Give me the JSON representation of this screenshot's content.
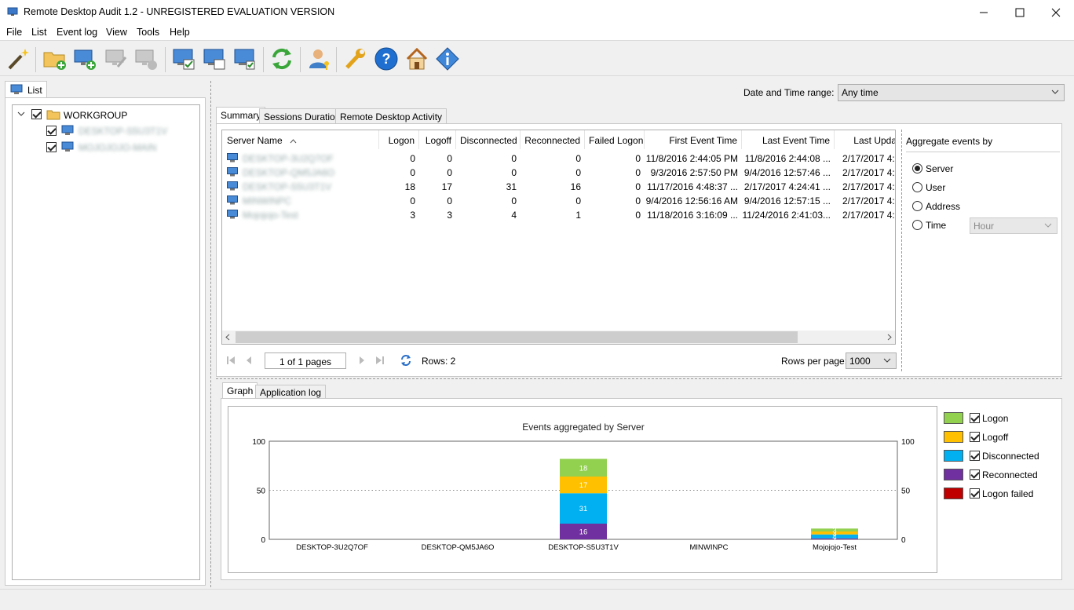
{
  "window": {
    "title": "Remote Desktop Audit 1.2 - UNREGISTERED EVALUATION VERSION"
  },
  "menu": [
    "File",
    "List",
    "Event log",
    "View",
    "Tools",
    "Help"
  ],
  "left": {
    "tab": "List",
    "tree": {
      "root": "WORKGROUP",
      "children": [
        "DESKTOP-S5U3T1V",
        "MOJOJOJO-MAIN"
      ]
    }
  },
  "range": {
    "label": "Date and Time range:",
    "value": "Any time"
  },
  "tabs": [
    "Summary",
    "Sessions Duration",
    "Remote Desktop Activity"
  ],
  "grid": {
    "headers": [
      "Server Name",
      "Logon",
      "Logoff",
      "Disconnected",
      "Reconnected",
      "Failed Logon",
      "First Event Time",
      "Last Event Time",
      "Last Upda"
    ],
    "rows": [
      [
        "DESKTOP-3U2Q7OF",
        "0",
        "0",
        "0",
        "0",
        "0",
        "11/8/2016 2:44:05 PM",
        "11/8/2016 2:44:08 ...",
        "2/17/2017 4:2"
      ],
      [
        "DESKTOP-QM5JA6O",
        "0",
        "0",
        "0",
        "0",
        "0",
        "9/3/2016 2:57:50 PM",
        "9/4/2016 12:57:46 ...",
        "2/17/2017 4:2"
      ],
      [
        "DESKTOP-S5U3T1V",
        "18",
        "17",
        "31",
        "16",
        "0",
        "11/17/2016 4:48:37 ...",
        "2/17/2017 4:24:41 ...",
        "2/17/2017 4:2"
      ],
      [
        "MINWINPC",
        "0",
        "0",
        "0",
        "0",
        "0",
        "9/4/2016 12:56:16 AM",
        "9/4/2016 12:57:15 ...",
        "2/17/2017 4:2"
      ],
      [
        "Mojojojo-Test",
        "3",
        "3",
        "4",
        "1",
        "0",
        "11/18/2016 3:16:09 ...",
        "11/24/2016 2:41:03...",
        "2/17/2017 4:2"
      ]
    ]
  },
  "pager": {
    "page": "1 of 1 pages",
    "rows": "Rows: 2",
    "per_page_label": "Rows per page:",
    "per_page": "1000"
  },
  "aggregate": {
    "title": "Aggregate events by",
    "options": [
      "Server",
      "User",
      "Address",
      "Time"
    ],
    "selected": "Server",
    "time_unit": "Hour"
  },
  "bottom_tabs": [
    "Graph",
    "Application log"
  ],
  "chart_data": {
    "type": "bar",
    "stacked": true,
    "title": "Events aggregated by Server",
    "categories": [
      "DESKTOP-3U2Q7OF",
      "DESKTOP-QM5JA6O",
      "DESKTOP-S5U3T1V",
      "MINWINPC",
      "Mojojojo-Test"
    ],
    "series": [
      {
        "name": "Reconnected",
        "values": [
          0,
          0,
          16,
          0,
          1
        ],
        "color": "#7030a0"
      },
      {
        "name": "Disconnected",
        "values": [
          0,
          0,
          31,
          0,
          4
        ],
        "color": "#00b0f0"
      },
      {
        "name": "Logoff",
        "values": [
          0,
          0,
          17,
          0,
          3
        ],
        "color": "#ffc000"
      },
      {
        "name": "Logon",
        "values": [
          0,
          0,
          18,
          0,
          3
        ],
        "color": "#92d050"
      },
      {
        "name": "Logon failed",
        "values": [
          0,
          0,
          0,
          0,
          0
        ],
        "color": "#c00000"
      }
    ],
    "ylim": [
      0,
      100
    ],
    "yticks": [
      "0",
      "50",
      "100"
    ],
    "legend_position": "right"
  },
  "legend": [
    {
      "label": "Logon",
      "color": "#92d050"
    },
    {
      "label": "Logoff",
      "color": "#ffc000"
    },
    {
      "label": "Disconnected",
      "color": "#00b0f0"
    },
    {
      "label": "Reconnected",
      "color": "#7030a0"
    },
    {
      "label": "Logon failed",
      "color": "#c00000"
    }
  ]
}
